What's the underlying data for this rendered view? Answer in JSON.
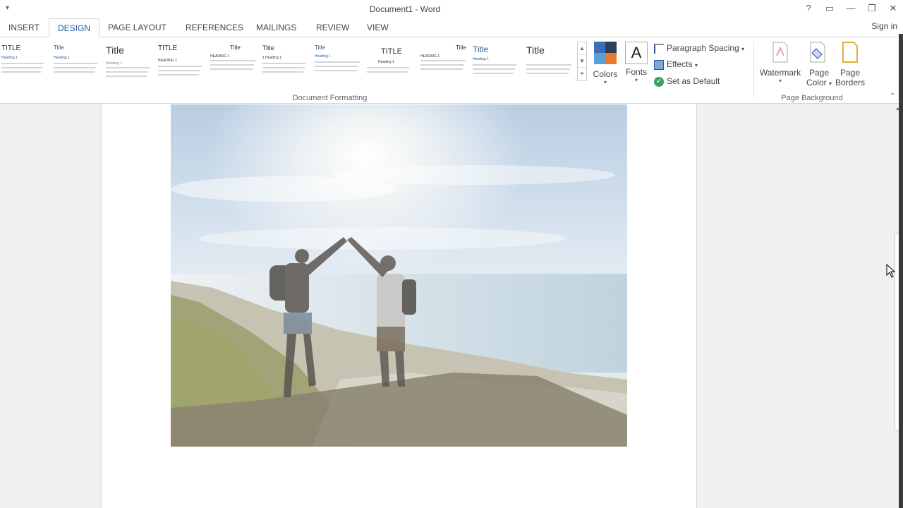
{
  "window": {
    "title": "Document1 - Word",
    "sign_in": "Sign in"
  },
  "tabs": [
    "INSERT",
    "DESIGN",
    "PAGE LAYOUT",
    "REFERENCES",
    "MAILINGS",
    "REVIEW",
    "VIEW"
  ],
  "active_tab": "DESIGN",
  "gallery": {
    "group_label": "Document Formatting",
    "styles": [
      {
        "title": "TITLE",
        "heading": "Heading 1"
      },
      {
        "title": "Title",
        "heading": "Heading 1"
      },
      {
        "title": "Title",
        "heading": "Heading 1"
      },
      {
        "title": "TITLE",
        "heading": "HEADING 1"
      },
      {
        "title": "Title",
        "heading": "HEADING 1"
      },
      {
        "title": "Title",
        "heading": "1 Heading 1"
      },
      {
        "title": "Title",
        "heading": "Heading 1"
      },
      {
        "title": "TITLE",
        "heading": "Heading 1"
      },
      {
        "title": "Title",
        "heading": "HEADING 1"
      },
      {
        "title": "Title",
        "heading": "Heading 1"
      },
      {
        "title": "Title",
        "heading": ""
      }
    ]
  },
  "colors_label": "Colors",
  "fonts_label": "Fonts",
  "paragraph_spacing_label": "Paragraph Spacing",
  "effects_label": "Effects",
  "set_default_label": "Set as Default",
  "page_background": {
    "group_label": "Page Background",
    "watermark_label": "Watermark",
    "page_color_label_1": "Page",
    "page_color_label_2": "Color",
    "page_borders_label_1": "Page",
    "page_borders_label_2": "Borders"
  },
  "colors": {
    "accent": "#2b579a",
    "page": "#ffffff",
    "sky_top": "#bdd2e6",
    "ground": "#6e6a55"
  },
  "icons": {
    "help": "?",
    "ribbon_display": "▭",
    "minimize": "—",
    "restore": "❐",
    "close": "✕"
  }
}
